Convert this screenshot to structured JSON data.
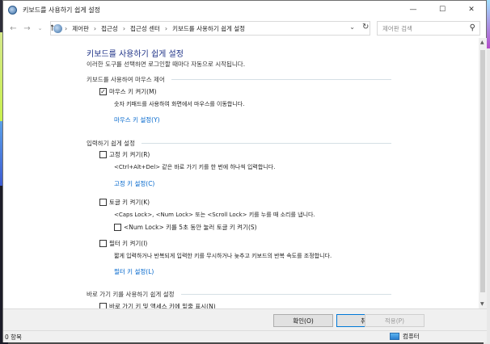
{
  "window": {
    "title": "키보드를 사용하기 쉽게 설정"
  },
  "address": {
    "crumbs": [
      "제어판",
      "접근성",
      "접근성 센터",
      "키보드를 사용하기 쉽게 설정"
    ],
    "search_placeholder": "제어판 검색"
  },
  "page": {
    "heading": "키보드를 사용하기 쉽게 설정",
    "subtitle": "이러한 도구를 선택하면 로그인할 때마다 자동으로 시작됩니다."
  },
  "mouse_section": {
    "title": "키보드를 사용하여 마우스 제어",
    "mouse_keys": {
      "label": "마우스 키 켜기(M)",
      "checked": true,
      "description": "숫자 키패드를 사용하여 화면에서 마우스를 이동합니다.",
      "link": "마우스 키 설정(Y)"
    }
  },
  "typing_section": {
    "title": "입력하기 쉽게 설정",
    "sticky_keys": {
      "label": "고정 키 켜기(R)",
      "checked": false,
      "description": "<Ctrl+Alt+Del> 같은 바로 가기 키를 한 번에 하나씩 입력합니다.",
      "link": "고정 키 설정(C)"
    },
    "toggle_keys": {
      "label": "토글 키 켜기(K)",
      "checked": false,
      "description": "<Caps Lock>, <Num Lock> 또는 <Scroll Lock> 키를 누를 때 소리를 냅니다.",
      "sub_option": {
        "label": "<Num Lock> 키를 5초 동안 눌러 토글 키 켜기(S)",
        "checked": false
      }
    },
    "filter_keys": {
      "label": "필터 키 켜기(I)",
      "checked": false,
      "description": "짧게 입력하거나 반복되게 입력한 키를 무시하거나 늦추고 키보드의 반복 속도를 조정합니다.",
      "link": "필터 키 설정(L)"
    }
  },
  "shortcut_section": {
    "title": "바로 가기 키를 사용하기 쉽게 설정",
    "underline_option": {
      "label": "바로 가기 키 및 액세스 키에 밑줄 표시(N)",
      "checked": false
    }
  },
  "buttons": {
    "ok": "확인(O)",
    "cancel": "취소",
    "apply": "적용(P)"
  },
  "status": {
    "items": "0 항목",
    "location": "컴퓨터"
  }
}
